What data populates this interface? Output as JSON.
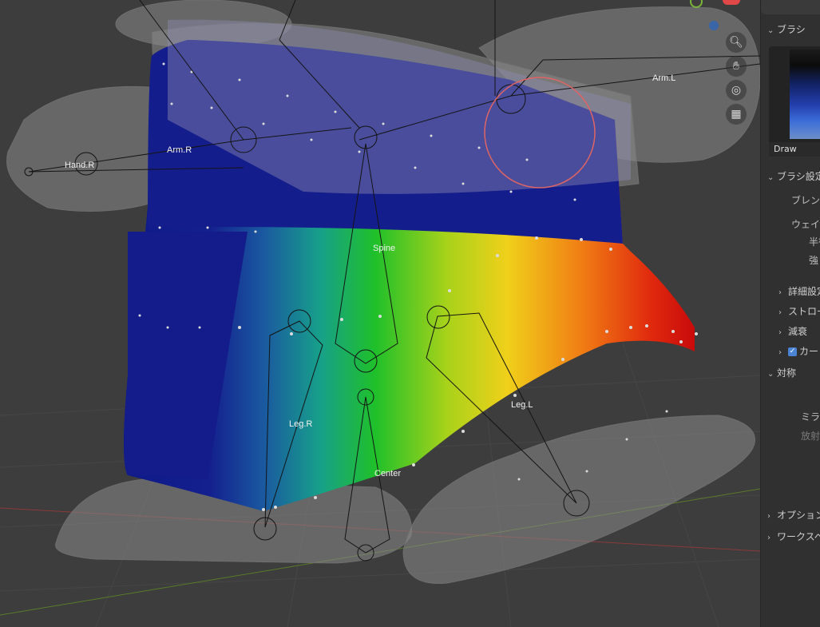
{
  "viewport": {
    "bones": [
      {
        "name": "Hand.R"
      },
      {
        "name": "Arm.R"
      },
      {
        "name": "Arm.L"
      },
      {
        "name": "Spine"
      },
      {
        "name": "Leg.R"
      },
      {
        "name": "Leg.L"
      },
      {
        "name": "Center"
      }
    ],
    "nav_icons": [
      "zoom-icon",
      "hand-icon",
      "camera-icon",
      "grid-icon"
    ]
  },
  "panel": {
    "brush_header": "ブラシ",
    "brush_name": "Draw",
    "brush_settings_header": "ブラシ設定",
    "blend_label": "ブレン",
    "weight_label": "ウェイ",
    "radius_label": "半径",
    "strength_label": "強さ",
    "advanced_label": "詳細設定",
    "stroke_label": "ストロー",
    "falloff_label": "減衰",
    "cursor_label": "カー",
    "symmetry_header": "対称",
    "mirror_label": "ミラー",
    "radial_label": "放射",
    "options_header": "オプション",
    "workspace_header": "ワークスペ"
  },
  "colors": {
    "background": "#3d3d3d",
    "panel": "#303030",
    "accent": "#4b84d4"
  }
}
